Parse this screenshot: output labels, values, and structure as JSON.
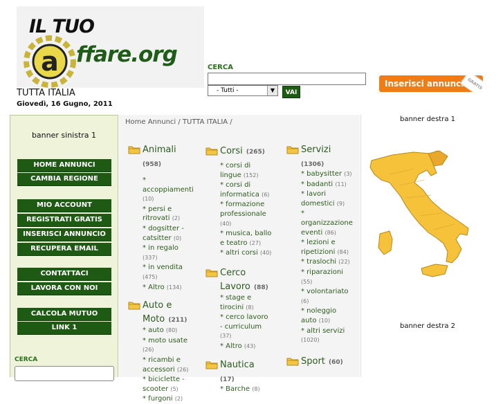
{
  "header": {
    "logo_line1": "IL TUO",
    "logo_line2": "ffare.org",
    "region": "TUTTA ITALIA",
    "date": "Giovedì, 16 Gugno, 2011",
    "search_label": "CERCA",
    "search_value": "",
    "category_selected": "- Tutti -",
    "go_button": "VAI",
    "insert_button": "Inserisci annuncio",
    "insert_tag": "GRATIS"
  },
  "sidebar": {
    "banner": "banner sinistra 1",
    "items": [
      {
        "label": "HOME ANNUNCI"
      },
      {
        "label": "CAMBIA REGIONE"
      },
      {
        "label": "MIO ACCOUNT"
      },
      {
        "label": "REGISTRATI GRATIS"
      },
      {
        "label": "INSERISCI ANNUNCIO"
      },
      {
        "label": "RECUPERA EMAIL"
      },
      {
        "label": "CONTATTACI"
      },
      {
        "label": "LAVORA CON NOI"
      },
      {
        "label": "CALCOLA MUTUO"
      },
      {
        "label": "LINK 1"
      }
    ],
    "search_label": "CERCA"
  },
  "breadcrumb": {
    "home": "Home Annunci",
    "sep1": " / ",
    "current": "TUTTA ITALIA",
    "sep2": " /"
  },
  "categories": [
    {
      "title": "Animali",
      "count": "(958)",
      "subs": [
        {
          "label": "* accoppiamenti",
          "count": "(10)"
        },
        {
          "label": "* persi e ritrovati",
          "count": "(2)"
        },
        {
          "label": "* dogsitter - catsitter",
          "count": "(0)"
        },
        {
          "label": "* in regalo",
          "count": "(337)"
        },
        {
          "label": "* in vendita",
          "count": "(475)"
        },
        {
          "label": "* Altro",
          "count": "(134)"
        }
      ]
    },
    {
      "title": "Auto e Moto",
      "count": "(211)",
      "subs": [
        {
          "label": "* auto",
          "count": "(80)"
        },
        {
          "label": "* moto usate",
          "count": "(26)"
        },
        {
          "label": "* ricambi e accessori",
          "count": "(26)"
        },
        {
          "label": "* biciclette - scooter",
          "count": "(5)"
        },
        {
          "label": "* furgoni",
          "count": "(2)"
        }
      ]
    },
    {
      "title": "Corsi",
      "count": "(265)",
      "subs": [
        {
          "label": "* corsi di lingue",
          "count": "(152)"
        },
        {
          "label": "* corsi di informatica",
          "count": "(6)"
        },
        {
          "label": "* formazione professionale",
          "count": "(40)"
        },
        {
          "label": "* musica, ballo e teatro",
          "count": "(27)"
        },
        {
          "label": "* altri corsi",
          "count": "(40)"
        }
      ]
    },
    {
      "title": "Cerco Lavoro",
      "count": "(88)",
      "subs": [
        {
          "label": "* stage e tirocini",
          "count": "(8)"
        },
        {
          "label": "* cerco lavoro - curriculum",
          "count": "(37)"
        },
        {
          "label": "* Altro",
          "count": "(43)"
        }
      ]
    },
    {
      "title": "Nautica",
      "count": "(17)",
      "subs": [
        {
          "label": "* Barche",
          "count": "(8)"
        }
      ]
    },
    {
      "title": "Servizi",
      "count": "(1306)",
      "subs": [
        {
          "label": "* babysitter",
          "count": "(3)"
        },
        {
          "label": "* badanti",
          "count": "(11)"
        },
        {
          "label": "* lavori domestici",
          "count": "(9)"
        },
        {
          "label": "* organizzazione eventi",
          "count": "(86)"
        },
        {
          "label": "* lezioni e ripetizioni",
          "count": "(84)"
        },
        {
          "label": "* traslochi",
          "count": "(22)"
        },
        {
          "label": "* riparazioni",
          "count": "(55)"
        },
        {
          "label": "* volontariato",
          "count": "(6)"
        },
        {
          "label": "* noleggio auto",
          "count": "(10)"
        },
        {
          "label": "* altri servizi",
          "count": "(1020)"
        }
      ]
    },
    {
      "title": "Sport",
      "count": "(60)",
      "subs": []
    }
  ],
  "right": {
    "banner1": "banner destra 1",
    "banner2": "banner destra 2"
  },
  "colors": {
    "nav_green": "#1f5a14",
    "link_green": "#2c5a1e",
    "orange": "#f07c16",
    "map_yellow": "#f5c23a"
  }
}
